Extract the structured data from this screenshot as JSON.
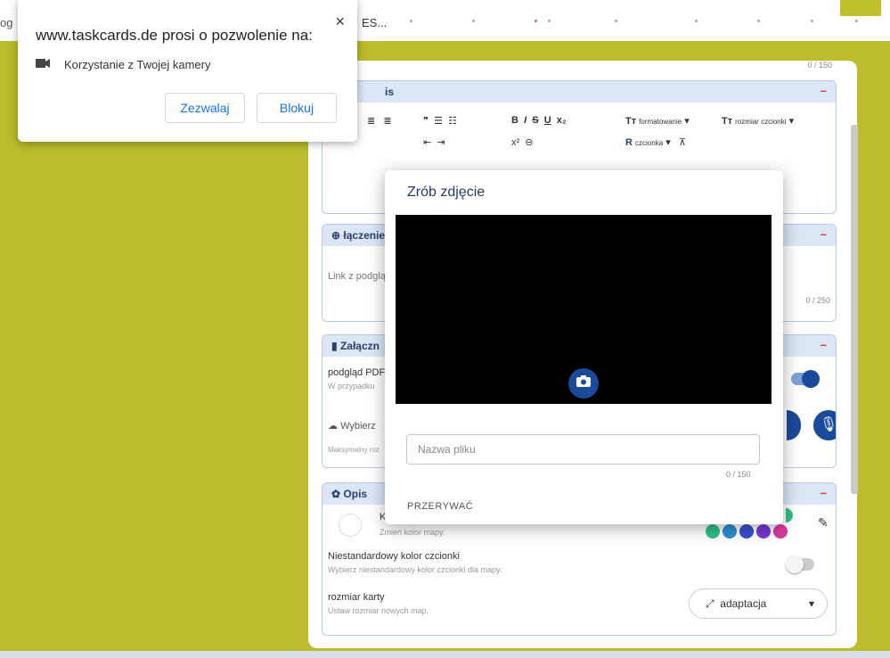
{
  "tab": {
    "partial_left": "og",
    "title_fragment": "ES..."
  },
  "permission": {
    "title": "www.taskcards.de prosi o pozwolenie na:",
    "request": "Korzystanie z Twojej kamery",
    "allow_label": "Zezwalaj",
    "block_label": "Blokuj",
    "close_glyph": "×"
  },
  "card": {
    "top_counter": "0 / 150",
    "opis_header": "is",
    "link_section": {
      "header": "łączenie",
      "placeholder": "Link z podglą",
      "counter": "0 / 250"
    },
    "attach_section": {
      "header": "Załączn",
      "pdf_label": "podgląd PDF",
      "pdf_sub": "W przypadku",
      "upload_label": "Wybierz",
      "max_size": "Maksymalny roz"
    },
    "style_section": {
      "header": "Opis",
      "color_label": "K",
      "color_sub": "Zmień kolor mapy.",
      "font_color_label": "Niestandardowy kolor czcionki",
      "font_color_sub": "Wybierz niestandardowy kolor czcionki dla mapy.",
      "size_label": "rozmiar karty",
      "size_sub": "Ustaw rozmiar nowych map.",
      "size_value": "adaptacja"
    },
    "toolbar": {
      "formatting": "formatowanie",
      "font_size": "rozmiar czcionki",
      "font": "czcionka"
    }
  },
  "dialog": {
    "title": "Zrób zdjęcie",
    "filename_placeholder": "Nazwa pliku",
    "counter": "0 / 150",
    "cancel_label": "PRZERYWAĆ"
  },
  "colors": {
    "page_bg": "#bcbc2e",
    "accent": "#1a4a9a",
    "palette": [
      "#2fbf8a",
      "#2a8fd4",
      "#3a4fd0",
      "#7b36d6",
      "#d63a9e"
    ]
  }
}
